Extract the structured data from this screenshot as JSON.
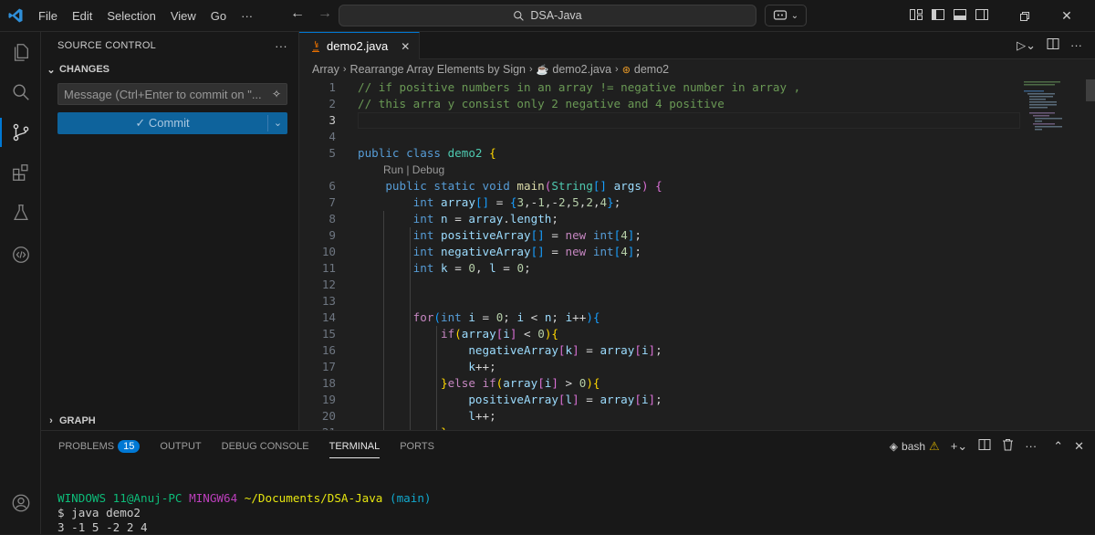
{
  "menu": [
    "File",
    "Edit",
    "Selection",
    "View",
    "Go",
    "···"
  ],
  "command_center": {
    "text": "DSA-Java"
  },
  "sidebar": {
    "title": "SOURCE CONTROL",
    "more": "···",
    "changes_label": "CHANGES",
    "message_placeholder": "Message (Ctrl+Enter to commit on \"...",
    "commit_label": "✓ Commit",
    "graph_label": "GRAPH"
  },
  "editor": {
    "tab_label": "demo2.java",
    "breadcrumb": [
      "Array",
      "Rearrange Array Elements by Sign",
      "demo2.java",
      "demo2"
    ],
    "codelens": "Run | Debug"
  },
  "code_lines": [
    {
      "n": "1",
      "segs": [
        {
          "c": "cm",
          "t": "// if positive numbers in an array != negative number in array ,"
        }
      ]
    },
    {
      "n": "2",
      "segs": [
        {
          "c": "cm",
          "t": "// this arra y consist only 2 negative and 4 positive"
        }
      ]
    },
    {
      "n": "3",
      "segs": []
    },
    {
      "n": "4",
      "segs": []
    },
    {
      "n": "5",
      "segs": [
        {
          "c": "kw",
          "t": "public "
        },
        {
          "c": "kw",
          "t": "class "
        },
        {
          "c": "cls",
          "t": "demo2 "
        },
        {
          "c": "b1",
          "t": "{"
        }
      ]
    },
    {
      "n": "6",
      "segs": [
        {
          "c": "pl",
          "t": "    "
        },
        {
          "c": "kw",
          "t": "public static void "
        },
        {
          "c": "fn",
          "t": "main"
        },
        {
          "c": "b2",
          "t": "("
        },
        {
          "c": "cls",
          "t": "String"
        },
        {
          "c": "b3",
          "t": "[]"
        },
        {
          "c": "var",
          "t": " args"
        },
        {
          "c": "b2",
          "t": ")"
        },
        {
          "c": "pl",
          "t": " "
        },
        {
          "c": "b2",
          "t": "{"
        }
      ]
    },
    {
      "n": "7",
      "segs": [
        {
          "c": "pl",
          "t": "        "
        },
        {
          "c": "kw",
          "t": "int "
        },
        {
          "c": "var",
          "t": "array"
        },
        {
          "c": "b3",
          "t": "[]"
        },
        {
          "c": "pl",
          "t": " = "
        },
        {
          "c": "b3",
          "t": "{"
        },
        {
          "c": "num",
          "t": "3"
        },
        {
          "c": "pl",
          "t": ",-"
        },
        {
          "c": "num",
          "t": "1"
        },
        {
          "c": "pl",
          "t": ",-"
        },
        {
          "c": "num",
          "t": "2"
        },
        {
          "c": "pl",
          "t": ","
        },
        {
          "c": "num",
          "t": "5"
        },
        {
          "c": "pl",
          "t": ","
        },
        {
          "c": "num",
          "t": "2"
        },
        {
          "c": "pl",
          "t": ","
        },
        {
          "c": "num",
          "t": "4"
        },
        {
          "c": "b3",
          "t": "}"
        },
        {
          "c": "pl",
          "t": ";"
        }
      ]
    },
    {
      "n": "8",
      "segs": [
        {
          "c": "pl",
          "t": "        "
        },
        {
          "c": "kw",
          "t": "int "
        },
        {
          "c": "var",
          "t": "n"
        },
        {
          "c": "pl",
          "t": " = "
        },
        {
          "c": "var",
          "t": "array"
        },
        {
          "c": "pl",
          "t": "."
        },
        {
          "c": "var",
          "t": "length"
        },
        {
          "c": "pl",
          "t": ";"
        }
      ]
    },
    {
      "n": "9",
      "segs": [
        {
          "c": "pl",
          "t": "        "
        },
        {
          "c": "kw",
          "t": "int "
        },
        {
          "c": "var",
          "t": "positiveArray"
        },
        {
          "c": "b3",
          "t": "[]"
        },
        {
          "c": "pl",
          "t": " = "
        },
        {
          "c": "kw2",
          "t": "new "
        },
        {
          "c": "kw",
          "t": "int"
        },
        {
          "c": "b3",
          "t": "["
        },
        {
          "c": "num",
          "t": "4"
        },
        {
          "c": "b3",
          "t": "]"
        },
        {
          "c": "pl",
          "t": ";"
        }
      ]
    },
    {
      "n": "10",
      "segs": [
        {
          "c": "pl",
          "t": "        "
        },
        {
          "c": "kw",
          "t": "int "
        },
        {
          "c": "var",
          "t": "negativeArray"
        },
        {
          "c": "b3",
          "t": "[]"
        },
        {
          "c": "pl",
          "t": " = "
        },
        {
          "c": "kw2",
          "t": "new "
        },
        {
          "c": "kw",
          "t": "int"
        },
        {
          "c": "b3",
          "t": "["
        },
        {
          "c": "num",
          "t": "4"
        },
        {
          "c": "b3",
          "t": "]"
        },
        {
          "c": "pl",
          "t": ";"
        }
      ]
    },
    {
      "n": "11",
      "segs": [
        {
          "c": "pl",
          "t": "        "
        },
        {
          "c": "kw",
          "t": "int "
        },
        {
          "c": "var",
          "t": "k"
        },
        {
          "c": "pl",
          "t": " = "
        },
        {
          "c": "num",
          "t": "0"
        },
        {
          "c": "pl",
          "t": ", "
        },
        {
          "c": "var",
          "t": "l"
        },
        {
          "c": "pl",
          "t": " = "
        },
        {
          "c": "num",
          "t": "0"
        },
        {
          "c": "pl",
          "t": ";"
        }
      ]
    },
    {
      "n": "12",
      "segs": []
    },
    {
      "n": "13",
      "segs": []
    },
    {
      "n": "14",
      "segs": [
        {
          "c": "pl",
          "t": "        "
        },
        {
          "c": "kw2",
          "t": "for"
        },
        {
          "c": "b3",
          "t": "("
        },
        {
          "c": "kw",
          "t": "int "
        },
        {
          "c": "var",
          "t": "i"
        },
        {
          "c": "pl",
          "t": " = "
        },
        {
          "c": "num",
          "t": "0"
        },
        {
          "c": "pl",
          "t": "; "
        },
        {
          "c": "var",
          "t": "i"
        },
        {
          "c": "pl",
          "t": " < "
        },
        {
          "c": "var",
          "t": "n"
        },
        {
          "c": "pl",
          "t": "; "
        },
        {
          "c": "var",
          "t": "i"
        },
        {
          "c": "pl",
          "t": "++"
        },
        {
          "c": "b3",
          "t": ")"
        },
        {
          "c": "b3",
          "t": "{"
        }
      ]
    },
    {
      "n": "15",
      "segs": [
        {
          "c": "pl",
          "t": "            "
        },
        {
          "c": "kw2",
          "t": "if"
        },
        {
          "c": "b1",
          "t": "("
        },
        {
          "c": "var",
          "t": "array"
        },
        {
          "c": "b2",
          "t": "["
        },
        {
          "c": "var",
          "t": "i"
        },
        {
          "c": "b2",
          "t": "]"
        },
        {
          "c": "pl",
          "t": " < "
        },
        {
          "c": "num",
          "t": "0"
        },
        {
          "c": "b1",
          "t": ")"
        },
        {
          "c": "b1",
          "t": "{"
        }
      ]
    },
    {
      "n": "16",
      "segs": [
        {
          "c": "pl",
          "t": "                "
        },
        {
          "c": "var",
          "t": "negativeArray"
        },
        {
          "c": "b2",
          "t": "["
        },
        {
          "c": "var",
          "t": "k"
        },
        {
          "c": "b2",
          "t": "]"
        },
        {
          "c": "pl",
          "t": " = "
        },
        {
          "c": "var",
          "t": "array"
        },
        {
          "c": "b2",
          "t": "["
        },
        {
          "c": "var",
          "t": "i"
        },
        {
          "c": "b2",
          "t": "]"
        },
        {
          "c": "pl",
          "t": ";"
        }
      ]
    },
    {
      "n": "17",
      "segs": [
        {
          "c": "pl",
          "t": "                "
        },
        {
          "c": "var",
          "t": "k"
        },
        {
          "c": "pl",
          "t": "++;"
        }
      ]
    },
    {
      "n": "18",
      "segs": [
        {
          "c": "pl",
          "t": "            "
        },
        {
          "c": "b1",
          "t": "}"
        },
        {
          "c": "kw2",
          "t": "else if"
        },
        {
          "c": "b1",
          "t": "("
        },
        {
          "c": "var",
          "t": "array"
        },
        {
          "c": "b2",
          "t": "["
        },
        {
          "c": "var",
          "t": "i"
        },
        {
          "c": "b2",
          "t": "]"
        },
        {
          "c": "pl",
          "t": " > "
        },
        {
          "c": "num",
          "t": "0"
        },
        {
          "c": "b1",
          "t": ")"
        },
        {
          "c": "b1",
          "t": "{"
        }
      ]
    },
    {
      "n": "19",
      "segs": [
        {
          "c": "pl",
          "t": "                "
        },
        {
          "c": "var",
          "t": "positiveArray"
        },
        {
          "c": "b2",
          "t": "["
        },
        {
          "c": "var",
          "t": "l"
        },
        {
          "c": "b2",
          "t": "]"
        },
        {
          "c": "pl",
          "t": " = "
        },
        {
          "c": "var",
          "t": "array"
        },
        {
          "c": "b2",
          "t": "["
        },
        {
          "c": "var",
          "t": "i"
        },
        {
          "c": "b2",
          "t": "]"
        },
        {
          "c": "pl",
          "t": ";"
        }
      ]
    },
    {
      "n": "20",
      "segs": [
        {
          "c": "pl",
          "t": "                "
        },
        {
          "c": "var",
          "t": "l"
        },
        {
          "c": "pl",
          "t": "++;"
        }
      ]
    },
    {
      "n": "21",
      "segs": [
        {
          "c": "pl",
          "t": "            "
        },
        {
          "c": "b1",
          "t": "}"
        }
      ]
    }
  ],
  "panel": {
    "tabs": [
      {
        "label": "PROBLEMS",
        "badge": "15"
      },
      {
        "label": "OUTPUT"
      },
      {
        "label": "DEBUG CONSOLE"
      },
      {
        "label": "TERMINAL",
        "active": true
      },
      {
        "label": "PORTS"
      }
    ],
    "shell_label": "bash",
    "terminal": {
      "prompt_user": "WINDOWS 11@Anuj-PC",
      "prompt_sys": "MINGW64",
      "prompt_path": "~/Documents/DSA-Java",
      "prompt_branch": "(main)",
      "command": "$ java demo2",
      "output": "3 -1 5 -2 2 4"
    }
  },
  "colors": {
    "accent": "#0078d4",
    "commit_button": "#0e639c"
  }
}
